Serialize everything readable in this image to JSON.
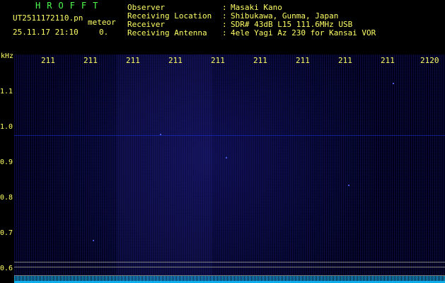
{
  "app": {
    "title": "HROFFT",
    "file_name": "UT2511172110.pn",
    "mode": "meteor",
    "datetime": "25.11.17 21:10",
    "count": "0."
  },
  "info": {
    "rows": [
      {
        "key": "Observer",
        "value": "Masaki Kano"
      },
      {
        "key": "Receiving Location",
        "value": "Shibukawa, Gunma, Japan"
      },
      {
        "key": "Receiver",
        "value": "SDR# 43dB L15 111.6MHz USB"
      },
      {
        "key": "Receiving Antenna",
        "value": "4ele Yagi Az 230 for Kansai VOR"
      }
    ]
  },
  "axes": {
    "unit": "kHz",
    "y_ticks": [
      "1.1",
      "1.0",
      "0.9",
      "0.8",
      "0.7",
      "0.6"
    ],
    "x_ticks": [
      "211",
      "211",
      "211",
      "211",
      "211",
      "211",
      "211",
      "211",
      "211",
      "2120"
    ]
  },
  "colors": {
    "text": "#ffff66",
    "title": "#4cff4c",
    "plot_background": "#03031d",
    "noise": "#18c8ff"
  }
}
